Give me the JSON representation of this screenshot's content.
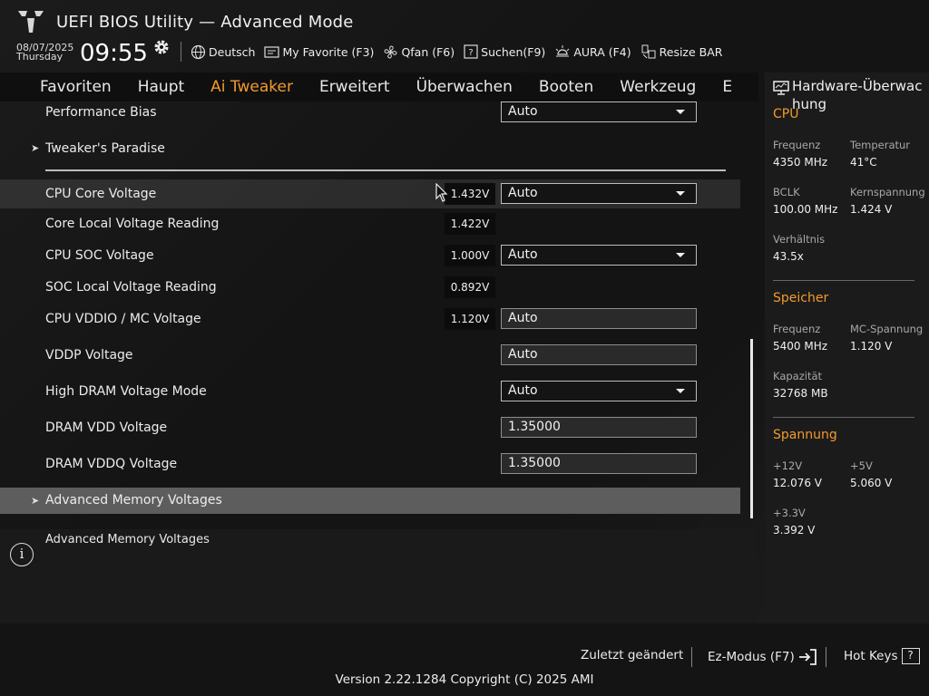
{
  "header": {
    "title": "UEFI BIOS Utility — Advanced Mode",
    "date": "08/07/2025",
    "weekday": "Thursday",
    "time": "09:55",
    "tools": [
      {
        "label": "Deutsch",
        "icon": "globe-icon"
      },
      {
        "label": "My Favorite (F3)",
        "icon": "favorite-icon"
      },
      {
        "label": "Qfan (F6)",
        "icon": "fan-icon"
      },
      {
        "label": "Suchen(F9)",
        "icon": "search-help-icon"
      },
      {
        "label": "AURA (F4)",
        "icon": "aura-icon"
      },
      {
        "label": "Resize BAR",
        "icon": "resize-bar-icon"
      }
    ]
  },
  "tabs": [
    {
      "label": "Favoriten",
      "active": false
    },
    {
      "label": "Haupt",
      "active": false
    },
    {
      "label": "Ai Tweaker",
      "active": true
    },
    {
      "label": "Erweitert",
      "active": false
    },
    {
      "label": "Überwachen",
      "active": false
    },
    {
      "label": "Booten",
      "active": false
    },
    {
      "label": "Werkzeug",
      "active": false
    },
    {
      "label": "E",
      "active": false
    }
  ],
  "settings": {
    "performance_bias": {
      "label": "Performance Bias",
      "value": "Auto"
    },
    "tweakers_paradise": {
      "label": "Tweaker's Paradise"
    },
    "cpu_core_voltage": {
      "label": "CPU Core Voltage",
      "reading": "1.432V",
      "value": "Auto"
    },
    "core_local_voltage": {
      "label": "Core Local Voltage Reading",
      "reading": "1.422V"
    },
    "cpu_soc_voltage": {
      "label": "CPU SOC Voltage",
      "reading": "1.000V",
      "value": "Auto"
    },
    "soc_local_voltage": {
      "label": "SOC Local Voltage Reading",
      "reading": "0.892V"
    },
    "cpu_vddio": {
      "label": "CPU VDDIO / MC Voltage",
      "reading": "1.120V",
      "value": "Auto"
    },
    "vddp": {
      "label": "VDDP Voltage",
      "value": "Auto"
    },
    "high_dram_mode": {
      "label": "High DRAM Voltage Mode",
      "value": "Auto"
    },
    "dram_vdd": {
      "label": "DRAM VDD Voltage",
      "value": "1.35000"
    },
    "dram_vddq": {
      "label": "DRAM VDDQ Voltage",
      "value": "1.35000"
    },
    "adv_mem_voltages": {
      "label": "Advanced Memory Voltages"
    }
  },
  "help": {
    "text": "Advanced Memory Voltages"
  },
  "hardware": {
    "title": "Hardware-Überwachung",
    "title_line1": "Hardware-Überwac",
    "title_line2": "hung",
    "cpu": {
      "section": "CPU",
      "freq_label": "Frequenz",
      "freq": "4350 MHz",
      "temp_label": "Temperatur",
      "temp": "41°C",
      "bclk_label": "BCLK",
      "bclk": "100.00 MHz",
      "core_v_label": "Kernspannung",
      "core_v": "1.424 V",
      "ratio_label": "Verhältnis",
      "ratio": "43.5x"
    },
    "memory": {
      "section": "Speicher",
      "freq_label": "Frequenz",
      "freq": "5400 MHz",
      "mc_v_label": "MC-Spannung",
      "mc_v": "1.120 V",
      "cap_label": "Kapazität",
      "cap": "32768 MB"
    },
    "voltage": {
      "section": "Spannung",
      "v12_label": "+12V",
      "v12": "12.076 V",
      "v5_label": "+5V",
      "v5": "5.060 V",
      "v33_label": "+3.3V",
      "v33": "3.392 V"
    }
  },
  "footer": {
    "last_changed": "Zuletzt geändert",
    "ez_mode": "Ez-Modus (F7)",
    "hot_keys": "Hot Keys",
    "hot_keys_key": "?",
    "version": "Version 2.22.1284 Copyright (C) 2025 AMI"
  },
  "colors": {
    "accent": "#f39a2c",
    "background": "#121212",
    "highlight_row": "#5d5d5d"
  }
}
